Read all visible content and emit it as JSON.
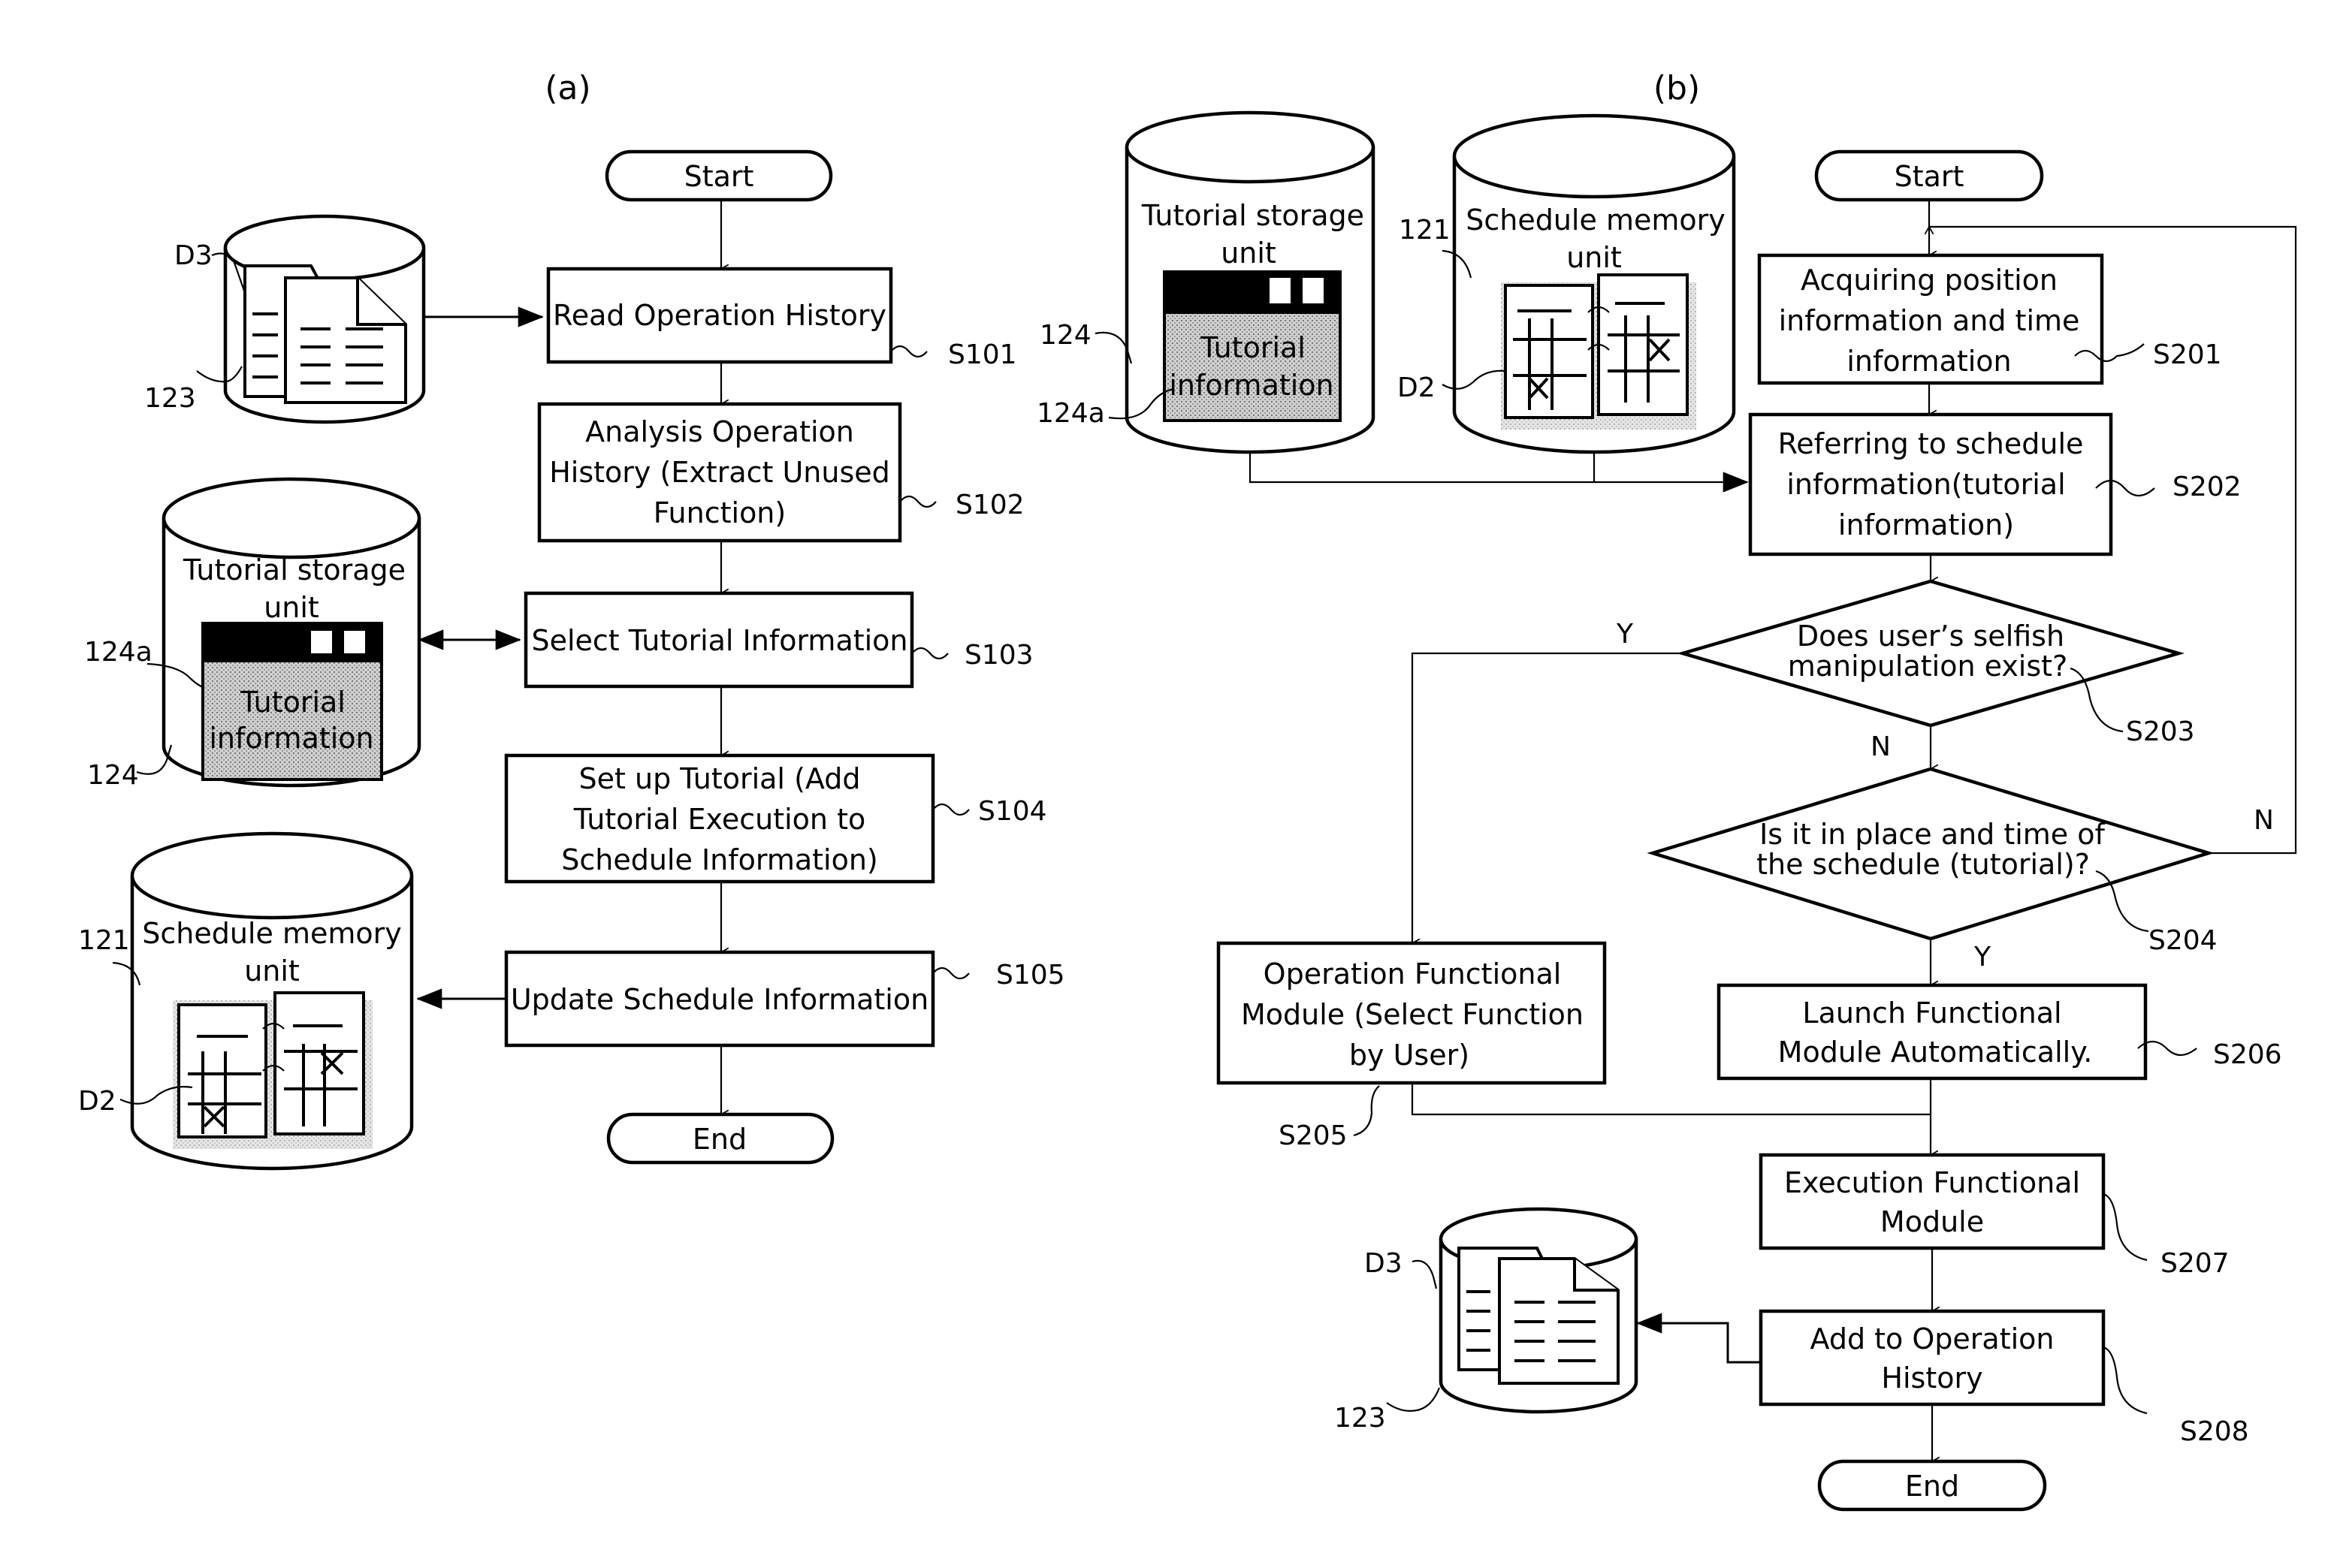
{
  "panels": {
    "a": {
      "label": "(a)",
      "start": "Start",
      "end": "End",
      "steps": [
        {
          "id": "S101",
          "lines": [
            "Read Operation History"
          ]
        },
        {
          "id": "S102",
          "lines": [
            "Analysis Operation",
            "History (Extract Unused",
            "Function)"
          ]
        },
        {
          "id": "S103",
          "lines": [
            "Select Tutorial Information"
          ]
        },
        {
          "id": "S104",
          "lines": [
            "Set up Tutorial (Add",
            "Tutorial Execution to",
            "Schedule Information)"
          ]
        },
        {
          "id": "S105",
          "lines": [
            "Update Schedule Information"
          ]
        }
      ],
      "stores": {
        "history": {
          "ref": "123",
          "doc_ref": "D3"
        },
        "tutorial": {
          "title_lines": [
            "Tutorial storage",
            "unit"
          ],
          "ref": "124",
          "sub_ref": "124a",
          "content_lines": [
            "Tutorial",
            "information"
          ]
        },
        "schedule": {
          "title_lines": [
            "Schedule memory",
            "unit"
          ],
          "ref": "121",
          "doc_ref": "D2"
        }
      }
    },
    "b": {
      "label": "(b)",
      "start": "Start",
      "end": "End",
      "steps": [
        {
          "id": "S201",
          "lines": [
            "Acquiring position",
            "information and time",
            "information"
          ]
        },
        {
          "id": "S202",
          "lines": [
            "Referring to schedule",
            "information(tutorial",
            "information)"
          ]
        },
        {
          "id": "S203",
          "lines": [
            "Does user’s selfish",
            "manipulation exist?"
          ]
        },
        {
          "id": "S204",
          "lines": [
            "Is it in place and time of",
            "the schedule (tutorial)?"
          ]
        },
        {
          "id": "S205",
          "lines": [
            "Operation Functional",
            "Module (Select Function",
            "by User)"
          ]
        },
        {
          "id": "S206",
          "lines": [
            "Launch Functional",
            "Module Automatically."
          ]
        },
        {
          "id": "S207",
          "lines": [
            "Execution Functional",
            "Module"
          ]
        },
        {
          "id": "S208",
          "lines": [
            "Add to Operation",
            "History"
          ]
        }
      ],
      "branches": {
        "S203_yes": "Y",
        "S203_no": "N",
        "S204_yes": "Y",
        "S204_no": "N"
      },
      "stores": {
        "tutorial": {
          "title_lines": [
            "Tutorial storage",
            "unit"
          ],
          "ref": "124",
          "sub_ref": "124a",
          "content_lines": [
            "Tutorial",
            "information"
          ]
        },
        "schedule": {
          "title_lines": [
            "Schedule memory",
            "unit"
          ],
          "ref": "121",
          "doc_ref": "D2"
        },
        "history": {
          "ref": "123",
          "doc_ref": "D3"
        }
      }
    }
  }
}
